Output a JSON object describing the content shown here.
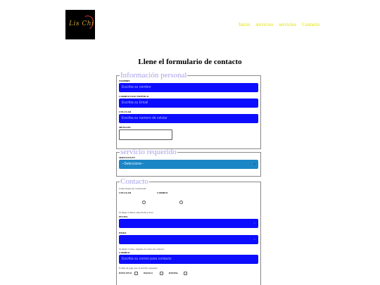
{
  "header": {
    "logo_text": "Lis Chi V",
    "nav": [
      "Inicio",
      "servicios",
      "servicios",
      "Contacto"
    ]
  },
  "page_title": "Llene el formulario de contacto",
  "personal": {
    "legend": "Información personal",
    "name_label": "NOMBRE",
    "name_placeholder": "Escriba su nombre",
    "email_label": "CORREO ELECTRÓNICO",
    "email_placeholder": "Escriba su Email",
    "phone_label": "CELULAR",
    "phone_placeholder": "Escriba su numero de celular",
    "message_label": "MENSAJE"
  },
  "service": {
    "legend": "servicio requerido",
    "label": "SERVICIO EN",
    "selected": "--Seleccione--"
  },
  "contact": {
    "legend": "Contacto",
    "how_note": "Cómo desea ser contactado:",
    "opt_cel": "CELULAR",
    "opt_mail": "CORREO",
    "cel_note": "Si eligió Celular, elija fecha y hora",
    "date_label": "FECHA",
    "time_label": "HORA",
    "mail_note": "Si eligió Correo, ingrese el correo de contacto",
    "mail_label": "CORREO",
    "mail_placeholder": "Escriba su correo para contacto",
    "pay_note": "Forma de pago por el servicio prestado",
    "pay_cash": "EFECTIVO",
    "pay_bank": "BANCO",
    "pay_paypal": "PAYPAL"
  },
  "colors": {
    "input_blue": "#0c0cff",
    "select_teal": "#1b86c6",
    "nav_yellow": "#e0e000",
    "legend_lavender": "#a8a0e8"
  }
}
